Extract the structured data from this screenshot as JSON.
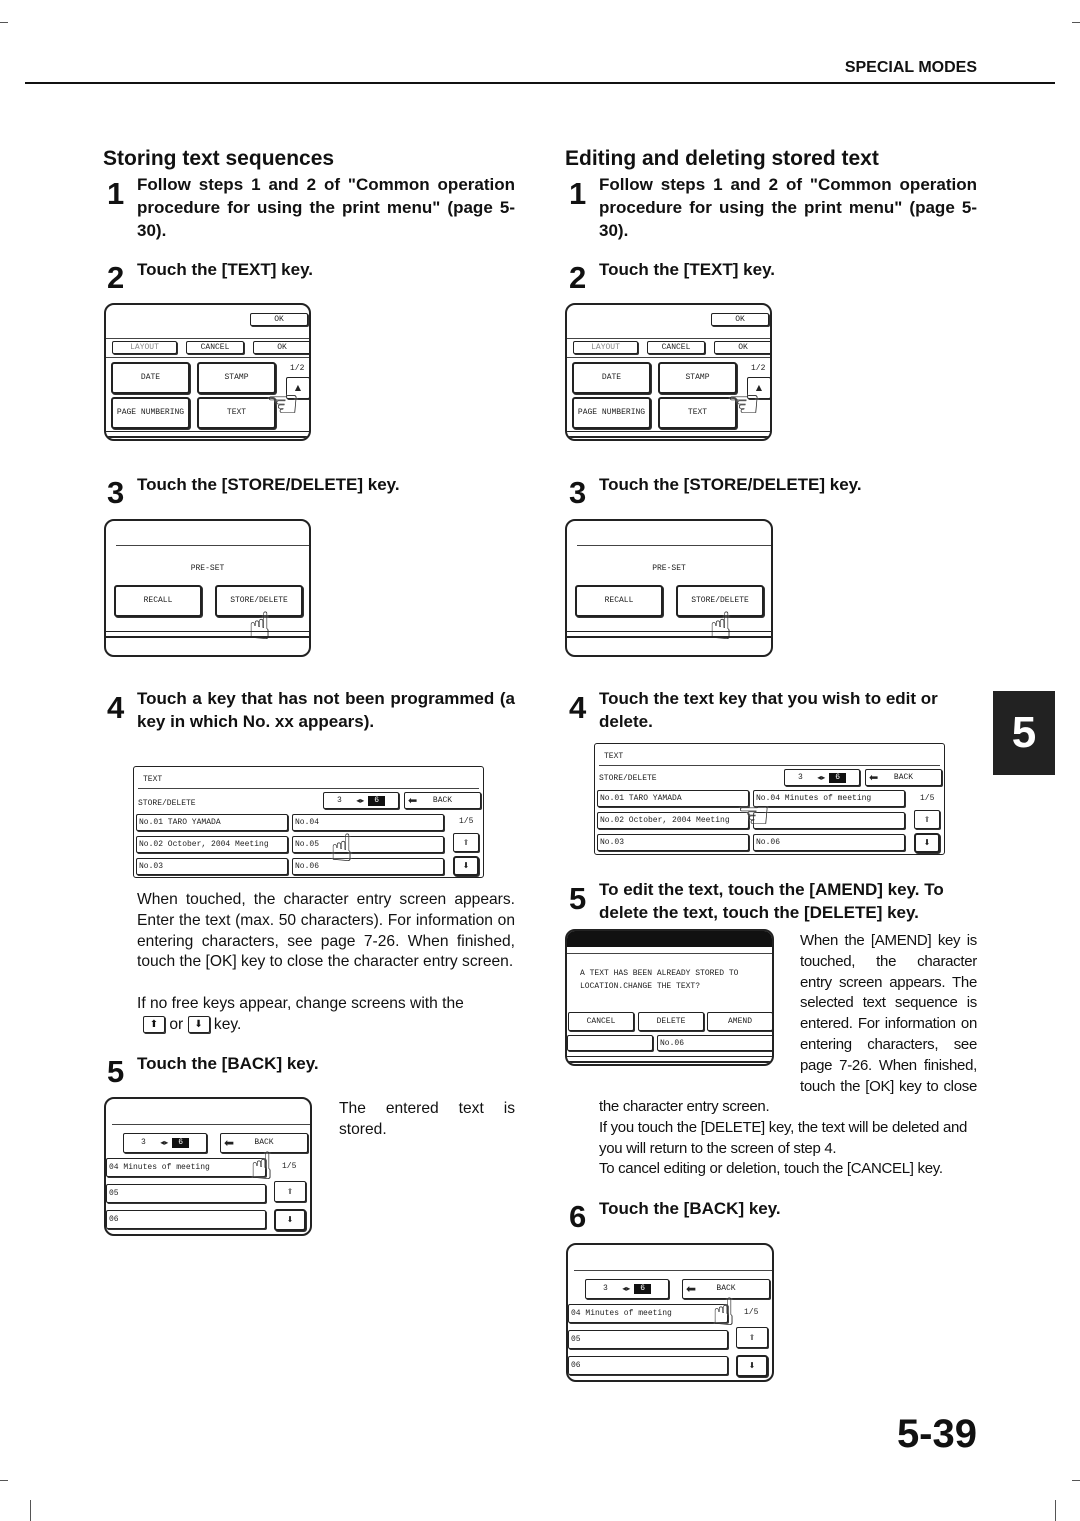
{
  "header": {
    "section": "SPECIAL MODES"
  },
  "side_tab": "5",
  "page_number": "5-39",
  "left": {
    "title": "Storing text sequences",
    "steps": [
      {
        "n": "1",
        "text": "Follow steps 1 and 2 of \"Common operation procedure for using the print menu\" (page 5-30)."
      },
      {
        "n": "2",
        "text": "Touch the [TEXT] key."
      },
      {
        "n": "3",
        "text": "Touch the [STORE/DELETE] key."
      },
      {
        "n": "4",
        "text": "Touch a key that has not been programmed (a key in which No. xx appears)."
      },
      {
        "n": "5",
        "text": "Touch the [BACK] key."
      }
    ],
    "step4_body": "When touched, the character entry screen appears. Enter the text (max. 50 characters). For information on entering characters, see page 7-26. When finished, touch the [OK] key to close the character entry screen.",
    "step4_body2_a": "If no free keys appear, change screens with the",
    "step4_or": "or",
    "step4_key": "key.",
    "step5_body": "The entered text is stored."
  },
  "right": {
    "title": "Editing and deleting stored text",
    "steps": [
      {
        "n": "1",
        "text": "Follow steps 1 and 2 of \"Common operation procedure for using the print menu\" (page 5-30)."
      },
      {
        "n": "2",
        "text": "Touch the [TEXT] key."
      },
      {
        "n": "3",
        "text": "Touch the [STORE/DELETE] key."
      },
      {
        "n": "4",
        "text": "Touch the text key that you wish to edit or delete."
      },
      {
        "n": "5",
        "text": "To edit the text, touch the [AMEND] key. To delete the text, touch the [DELETE] key."
      },
      {
        "n": "6",
        "text": "Touch the [BACK] key."
      }
    ],
    "step5_body": "When the [AMEND] key is touched, the character entry screen appears. The selected text sequence is entered. For information on entering characters, see page 7-26. When finished, touch the [OK] key to close the character entry screen.",
    "step5_body2": "If you touch the [DELETE] key, the text will be deleted and you will return to the screen of step 4.",
    "step5_body3": "To cancel editing or deletion, touch the [CANCEL] key."
  },
  "screens": {
    "print_menu": {
      "ok_top": "OK",
      "layout": "LAYOUT",
      "cancel": "CANCEL",
      "ok": "OK",
      "date": "DATE",
      "stamp": "STAMP",
      "page_numbering": "PAGE NUMBERING",
      "text": "TEXT",
      "page": "1/2"
    },
    "preset": {
      "label": "PRE-SET",
      "recall": "RECALL",
      "store_delete": "STORE/DELETE"
    },
    "store_list_empty": {
      "title": "TEXT",
      "mode": "STORE/DELETE",
      "counter_a": "3",
      "counter_b": "6",
      "back": "BACK",
      "page": "1/5",
      "cells": [
        "No.01 TARO YAMADA",
        "No.04",
        "No.02 October, 2004 Meeting",
        "No.05",
        "No.03",
        "No.06"
      ]
    },
    "store_list_filled": {
      "title": "TEXT",
      "mode": "STORE/DELETE",
      "counter_a": "3",
      "counter_b": "6",
      "back": "BACK",
      "page": "1/5",
      "cells": [
        "No.01 TARO YAMADA",
        "No.04 Minutes of meeting",
        "No.02 October, 2004 Meeting",
        "",
        "No.03",
        "No.06"
      ]
    },
    "confirm": {
      "message_1": "A TEXT HAS BEEN ALREADY STORED TO",
      "message_2": "LOCATION.CHANGE THE TEXT?",
      "cancel": "CANCEL",
      "delete": "DELETE",
      "amend": "AMEND",
      "cell": "No.06"
    },
    "back_screen": {
      "counter_a": "3",
      "counter_b": "6",
      "back": "BACK",
      "page": "1/5",
      "rows": [
        "04 Minutes of meeting",
        "05",
        "06"
      ]
    }
  },
  "icons": {
    "hand": "pointing-hand-icon",
    "up": "up-arrow-icon",
    "down": "down-arrow-icon",
    "back": "left-arrow-icon",
    "swap": "left-right-arrow-icon"
  }
}
